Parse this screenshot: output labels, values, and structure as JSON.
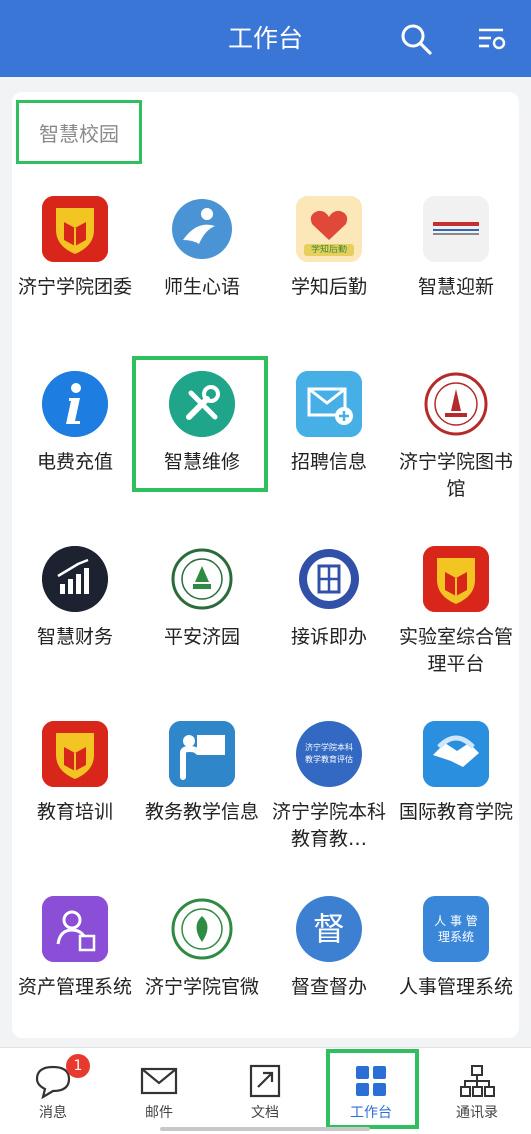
{
  "header": {
    "title": "工作台"
  },
  "section": {
    "title": "智慧校园"
  },
  "apps": [
    {
      "label": "济宁学院团委",
      "icon": "shield-book-icon"
    },
    {
      "label": "师生心语",
      "icon": "person-swoosh-icon"
    },
    {
      "label": "学知后勤",
      "icon": "heart-hands-icon",
      "icon_text": "学知后勤"
    },
    {
      "label": "智慧迎新",
      "icon": "banner-icon"
    },
    {
      "label": "电费充值",
      "icon": "info-icon"
    },
    {
      "label": "智慧维修",
      "icon": "tools-icon"
    },
    {
      "label": "招聘信息",
      "icon": "mail-plus-icon"
    },
    {
      "label": "济宁学院图书馆",
      "icon": "library-seal-icon"
    },
    {
      "label": "智慧财务",
      "icon": "chart-growth-icon"
    },
    {
      "label": "平安济园",
      "icon": "campus-seal-icon"
    },
    {
      "label": "接诉即办",
      "icon": "book-badge-icon"
    },
    {
      "label": "实验室综合管理平台",
      "icon": "shield-book-icon"
    },
    {
      "label": "教育培训",
      "icon": "shield-book-icon"
    },
    {
      "label": "教务教学信息",
      "icon": "teacher-board-icon"
    },
    {
      "label": "济宁学院本科教育教…",
      "icon": "evaluation-badge-icon",
      "icon_text": "济宁学院本科教学教育评估"
    },
    {
      "label": "国际教育学院",
      "icon": "handshake-icon"
    },
    {
      "label": "资产管理系统",
      "icon": "user-document-icon"
    },
    {
      "label": "济宁学院官微",
      "icon": "university-seal-icon"
    },
    {
      "label": "督查督办",
      "icon": "supervise-icon",
      "icon_text": "督"
    },
    {
      "label": "人事管理系统",
      "icon": "hr-system-icon",
      "icon_text": "人 事 管理系统"
    }
  ],
  "bottom_nav": [
    {
      "label": "消息",
      "icon": "chat-bubble-icon",
      "badge": "1"
    },
    {
      "label": "邮件",
      "icon": "mail-icon"
    },
    {
      "label": "文档",
      "icon": "document-icon"
    },
    {
      "label": "工作台",
      "icon": "grid-icon",
      "active": true
    },
    {
      "label": "通讯录",
      "icon": "org-chart-icon"
    }
  ],
  "colors": {
    "header_bg": "#3a76d6",
    "highlight": "#2fbf5e",
    "active_tab": "#2b6fd6",
    "badge": "#e8392f"
  }
}
